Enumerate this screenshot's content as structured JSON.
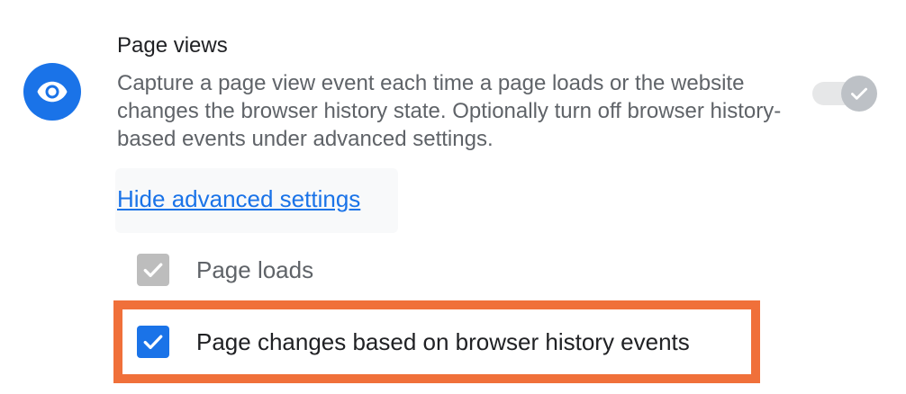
{
  "section": {
    "icon": "eye-icon",
    "title": "Page views",
    "description": "Capture a page view event each time a page loads or the website changes the browser history state. Optionally turn off browser history-based events under advanced settings.",
    "toggle_state": "on-disabled"
  },
  "advanced": {
    "link_label": "Hide advanced settings"
  },
  "options": [
    {
      "label": "Page loads",
      "checked": true,
      "disabled": true
    },
    {
      "label": "Page changes based on browser history events",
      "checked": true,
      "disabled": false
    }
  ],
  "colors": {
    "accent": "#1a73e8",
    "highlight": "#f0703a",
    "disabled": "#bdbdbd"
  }
}
